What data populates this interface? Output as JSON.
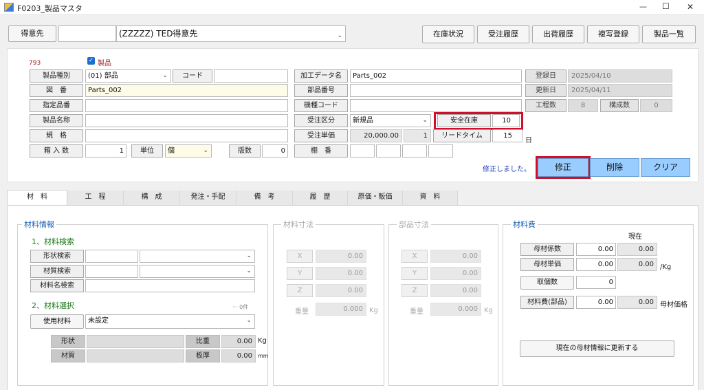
{
  "window": {
    "title": "F0203_製品マスタ",
    "min": "—",
    "max": "☐",
    "close": "✕"
  },
  "header": {
    "customer_label": "得意先",
    "customer_code": "",
    "customer_name": "(ZZZZZ) TED得意先"
  },
  "toolbar": {
    "stock": "在庫状況",
    "order_hist": "受注履歴",
    "ship_hist": "出荷履歴",
    "copy_reg": "複写登録",
    "product_list": "製品一覧"
  },
  "form": {
    "id": "793",
    "product_check": "製品",
    "type_label": "製品種別",
    "type_value": "(01) 部品",
    "code_label": "コード",
    "code_value": "",
    "drawing_label": "図　番",
    "drawing_value": "Parts_002",
    "spec_part_label": "指定品番",
    "spec_part_value": "",
    "name_label": "製品名称",
    "name_value": "",
    "spec_label": "規　格",
    "spec_value": "",
    "box_label": "箱 入 数",
    "box_value": "1",
    "unit_label": "単位",
    "unit_value": "個",
    "version_label": "版数",
    "version_value": "0",
    "proc_data_label": "加工データ名",
    "proc_data_value": "Parts_002",
    "part_no_label": "部品番号",
    "part_no_value": "",
    "model_code_label": "機種コード",
    "model_code_value": "",
    "order_type_label": "受注区分",
    "order_type_value": "新規品",
    "safety_stock_label": "安全在庫",
    "safety_stock_value": "10",
    "order_price_label": "受注単価",
    "order_price_value": "20,000.00",
    "order_qty": "1",
    "lead_time_label": "リードタイム",
    "lead_time_value": "15",
    "lead_time_unit": "日",
    "shelf_label": "棚　番",
    "reg_date_label": "登録日",
    "reg_date_value": "2025/04/10",
    "upd_date_label": "更新日",
    "upd_date_value": "2025/04/11",
    "proc_count_label": "工程数",
    "proc_count_value": "8",
    "comp_count_label": "構成数",
    "comp_count_value": "0",
    "status_msg": "修正しました。"
  },
  "actions": {
    "modify": "修正",
    "delete": "削除",
    "clear": "クリア"
  },
  "tabs": [
    "材　料",
    "工　程",
    "構　成",
    "発注・手配",
    "備　考",
    "履　歴",
    "原価・販価",
    "資　料"
  ],
  "material": {
    "title": "材料情報",
    "search_title": "1、材料検索",
    "shape_search": "形状検索",
    "quality_search": "材質検索",
    "name_search": "材料名検索",
    "select_title": "2、材料選択",
    "count": "··· 0件",
    "use_label": "使用材料",
    "use_value": "未設定",
    "shape_label": "形状",
    "ratio_label": "比重",
    "ratio_value": "0.00",
    "ratio_unit": "Kg",
    "quality_label": "材質",
    "thick_label": "板厚",
    "thick_value": "0.00",
    "thick_unit": "mm"
  },
  "dims": {
    "title": "材料寸法",
    "x": "X",
    "y": "Y",
    "z": "Z",
    "x_val": "0.00",
    "y_val": "0.00",
    "z_val": "0.00",
    "weight_label": "重量",
    "weight_val": "0.000",
    "weight_unit": "Kg"
  },
  "part_dims": {
    "title": "部品寸法",
    "x": "X",
    "y": "Y",
    "z": "Z",
    "x_val": "0.00",
    "y_val": "0.00",
    "z_val": "0.00",
    "weight_label": "重量",
    "weight_val": "0.000",
    "weight_unit": "Kg"
  },
  "cost": {
    "title": "材料費",
    "current": "現在",
    "factor_label": "母材係数",
    "factor_val": "0.00",
    "factor_cur": "0.00",
    "unit_price_label": "母材単価",
    "unit_price_val": "0.00",
    "unit_price_cur": "0.00",
    "unit_price_unit": "/Kg",
    "take_label": "取個数",
    "take_val": "0",
    "part_cost_label": "材料費(部品)",
    "part_cost_val": "0.00",
    "part_cost_cur": "0.00",
    "part_cost_unit": "母材価格",
    "update_btn": "現在の母材情報に更新する"
  }
}
